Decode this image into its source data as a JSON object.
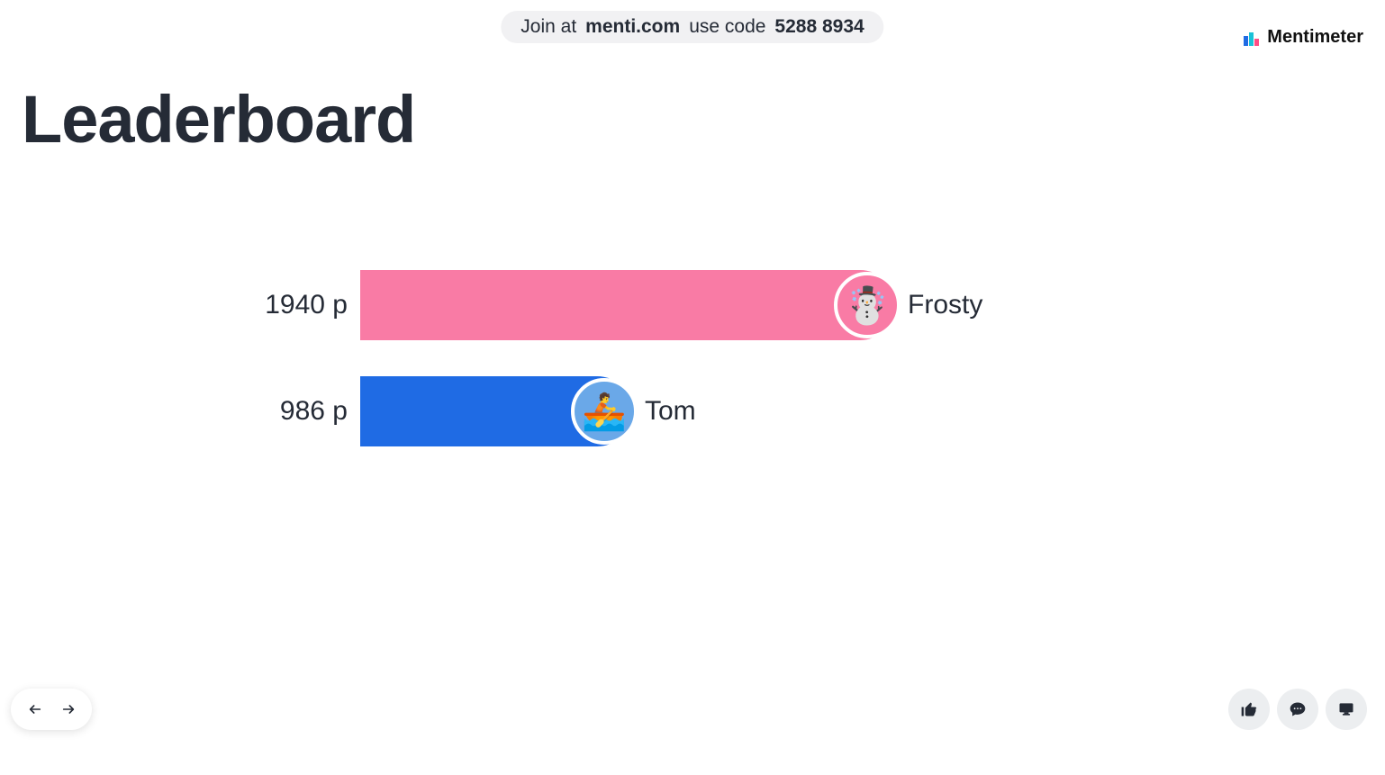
{
  "join": {
    "prefix": "Join at",
    "site": "menti.com",
    "use_code_label": "use code",
    "code": "5288 8934"
  },
  "brand": {
    "name": "Mentimeter"
  },
  "title": "Leaderboard",
  "chart_data": {
    "type": "bar",
    "orientation": "horizontal",
    "unit": "p",
    "categories": [
      "Frosty",
      "Tom"
    ],
    "values": [
      1940,
      986
    ],
    "series": [
      {
        "name": "Frosty",
        "value": 1940,
        "color": "#f97ba5",
        "avatar_bg": "#f97ba5",
        "avatar_emoji": "☃️"
      },
      {
        "name": "Tom",
        "value": 986,
        "color": "#1f6be4",
        "avatar_bg": "#6aa8e8",
        "avatar_emoji": "🚣"
      }
    ]
  },
  "leaderboard": {
    "rows": [
      {
        "score_text": "1940 p",
        "name": "Frosty"
      },
      {
        "score_text": "986 p",
        "name": "Tom"
      }
    ]
  },
  "nav": {
    "prev": "previous-slide",
    "next": "next-slide"
  },
  "actions": {
    "thumbs": "thumbs-up",
    "comment": "comment",
    "present": "present"
  }
}
